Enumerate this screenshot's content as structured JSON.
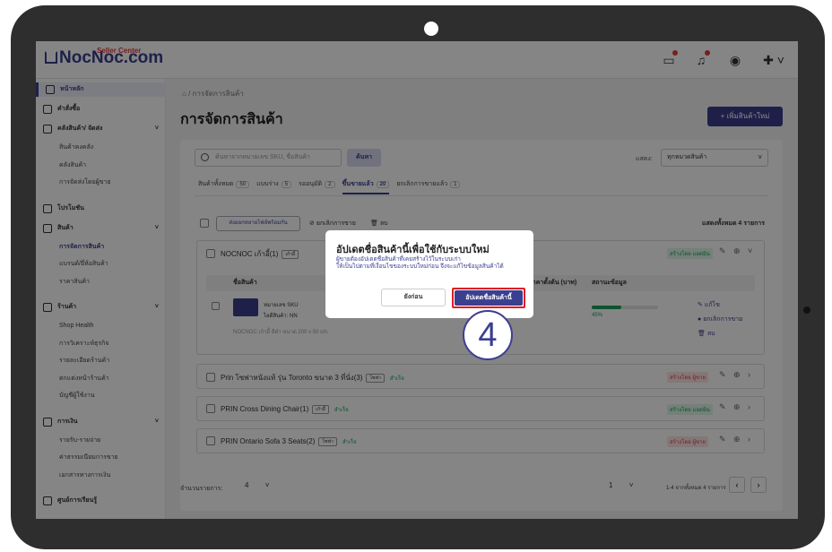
{
  "app": {
    "logo": "NocNoc.com",
    "logo_sub": "Seller Center"
  },
  "topbar": {
    "icons": [
      "chat-icon",
      "bell-icon",
      "account-icon",
      "language-flag-icon"
    ]
  },
  "sidebar": {
    "items": [
      {
        "label": "หน้าหลัก",
        "type": "main",
        "icon": "home-icon"
      },
      {
        "label": "คำสั่งซื้อ",
        "type": "main",
        "icon": "order-icon"
      },
      {
        "label": "คลังสินค้า/ จัดส่ง",
        "type": "main",
        "icon": "warehouse-icon"
      },
      {
        "label": "สินค้าคงคลัง",
        "type": "sub"
      },
      {
        "label": "คลังสินค้า",
        "type": "sub"
      },
      {
        "label": "การจัดส่งโดยผู้ขาย",
        "type": "sub"
      },
      {
        "label": "โปรโมชัน",
        "type": "main",
        "icon": "promo-icon"
      },
      {
        "label": "สินค้า",
        "type": "main",
        "icon": "product-icon"
      },
      {
        "label": "การจัดการสินค้า",
        "type": "sub",
        "active": true
      },
      {
        "label": "แบรนด์/ยี่ห้อสินค้า",
        "type": "sub"
      },
      {
        "label": "ราคาสินค้า",
        "type": "sub"
      },
      {
        "label": "ร้านค้า",
        "type": "main",
        "icon": "shop-icon"
      },
      {
        "label": "Shop Health",
        "type": "sub"
      },
      {
        "label": "การวิเคราะห์ธุรกิจ",
        "type": "sub"
      },
      {
        "label": "รายละเอียดร้านค้า",
        "type": "sub"
      },
      {
        "label": "ตกแต่งหน้าร้านค้า",
        "type": "sub"
      },
      {
        "label": "บัญชีผู้ใช้งาน",
        "type": "sub"
      },
      {
        "label": "การเงิน",
        "type": "main",
        "icon": "finance-icon"
      },
      {
        "label": "รายรับ-รายจ่าย",
        "type": "sub"
      },
      {
        "label": "ค่าธรรมเนียมการขาย",
        "type": "sub"
      },
      {
        "label": "เอกสารทางการเงิน",
        "type": "sub"
      },
      {
        "label": "ศูนย์การเรียนรู้",
        "type": "main",
        "icon": "learning-icon"
      }
    ]
  },
  "breadcrumb": "/ การจัดการสินค้า",
  "page_title": "การจัดการสินค้า",
  "add_button": "+ เพิ่มสินค้าใหม่",
  "search": {
    "placeholder": "ค้นหาจากหมายเลข SKU, ชื่อสินค้า",
    "button": "ค้นหา"
  },
  "filter": {
    "label": "แสดง:",
    "value": "ทุกหมวดสินค้า"
  },
  "tabs": [
    {
      "label": "สินค้าทั้งหมด",
      "count": "50"
    },
    {
      "label": "แบบร่าง",
      "count": "5"
    },
    {
      "label": "รออนุมัติ",
      "count": "2"
    },
    {
      "label": "ขึ้นขายแล้ว",
      "count": "20",
      "active": true
    },
    {
      "label": "ยกเลิกการขายแล้ว",
      "count": "1"
    }
  ],
  "actions": {
    "bulk": "ส่งออกหลายไฟล์พร้อมกัน",
    "cancel_sale": "ยกเลิกการขาย",
    "delete": "ลบ",
    "total": "แสดงทั้งหมด 4 รายการ"
  },
  "groups": [
    {
      "title": "NOCNOC เก้าอี้(1)",
      "tag": "เก้าอี้",
      "status": "สร้างโดย แอดมิน",
      "status_color": "green"
    },
    {
      "title": "Prin โซฟาหนังแท้ รุ่น Toronto ขนาด 3 ที่นั่ง(3)",
      "tag": "โซฟา",
      "ok": "สำเร็จ",
      "status": "สร้างโดย ผู้ขาย",
      "status_color": "red"
    },
    {
      "title": "PRIN Cross Dining Chair(1)",
      "tag": "เก้าอี้",
      "ok": "สำเร็จ",
      "status": "สร้างโดย แอดมิน",
      "status_color": "green"
    },
    {
      "title": "PRIN Ontario Sofa 3 Seats(2)",
      "tag": "โซฟา",
      "ok": "สำเร็จ",
      "status": "สร้างโดย ผู้ขาย",
      "status_color": "red"
    }
  ],
  "table": {
    "col_product": "ชื่อสินค้า",
    "col_price": "ราคาตั้งต้น (บาท)",
    "col_status": "สถานะข้อมูล",
    "row": {
      "name": "หมายเลข SKU",
      "sku": "ไอดีสินค้า: NN",
      "desc": "NOCNOC เก้าอี้ สีดำ ขนาด 200 x 50 cm.",
      "progress": 45,
      "progress_label": "45%"
    },
    "row_actions": {
      "edit": "แก้ไข",
      "cancel": "ยกเลิกการขาย",
      "delete": "ลบ"
    }
  },
  "pagination": {
    "per_page_label": "จำนวนรายการ:",
    "per_page": "4",
    "page": "1",
    "range": "1-4 จากทั้งหมด 4 รายการ"
  },
  "modal": {
    "title": "อัปเดตชื่อสินค้านี้เพื่อใช้กับระบบใหม่",
    "desc1": "ผู้ขายต้องอัปเดตชื่อสินค้าที่เคยสร้างไว้ในระบบเก่า",
    "desc2": "ให้เป็นไปตามที่เงื่อนไขของระบบใหม่ก่อน จึงจะแก้ไขข้อมูลสินค้าได้",
    "later": "ยังก่อน",
    "update": "อัปเดตชื่อสินค้านี้"
  },
  "step_marker": "4",
  "colors": {
    "brand": "#3b3f8f",
    "highlight": "#e11b22",
    "success": "#1aa05b"
  }
}
